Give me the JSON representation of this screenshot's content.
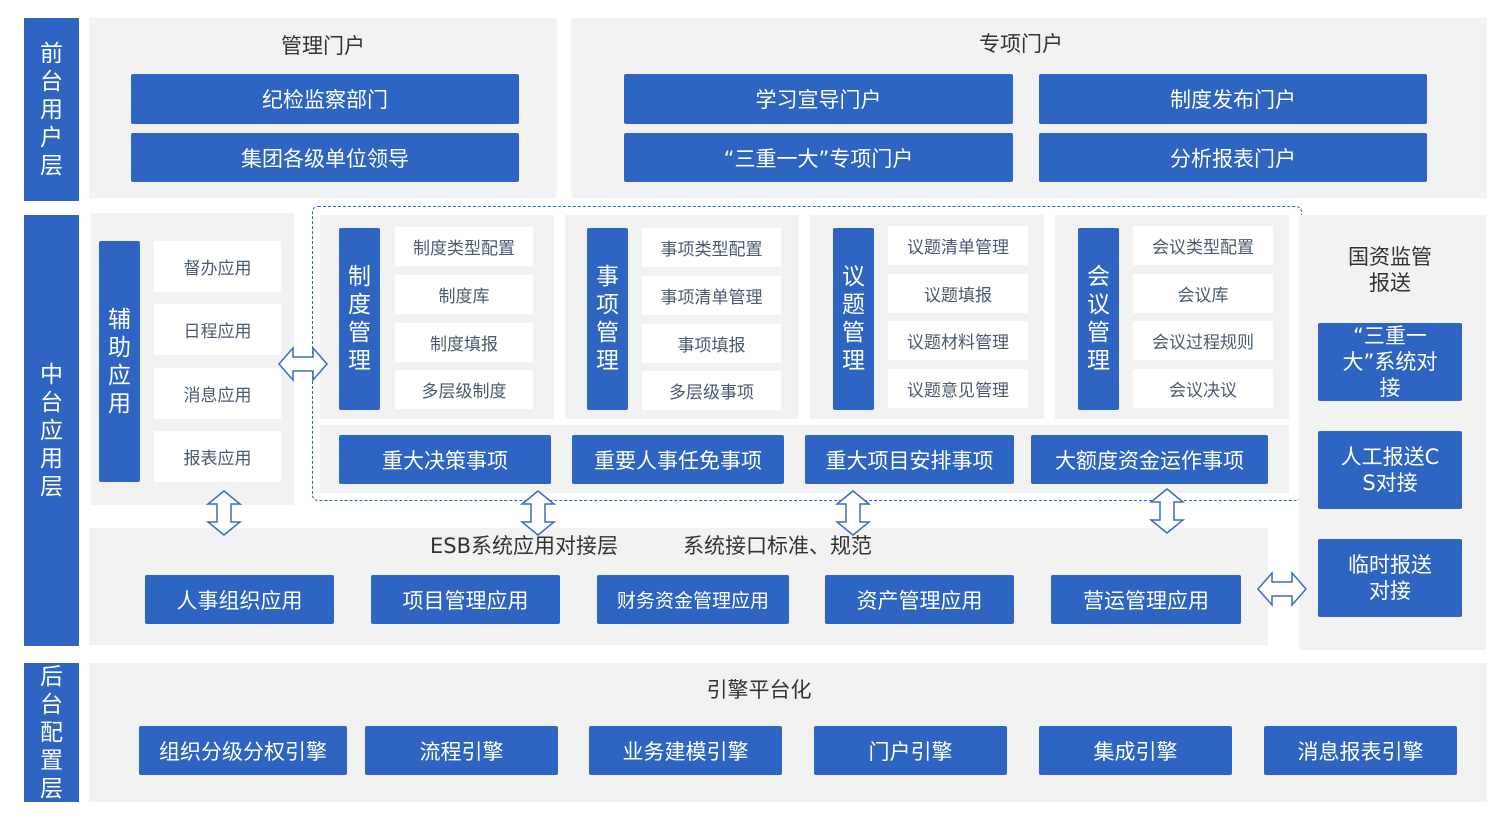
{
  "layers": {
    "front": "前台用户层",
    "middle": "中台应用层",
    "back": "后台配置层"
  },
  "front": {
    "mgmt_portal": {
      "title": "管理门户",
      "items": [
        "纪检监察部门",
        "集团各级单位领导"
      ]
    },
    "special_portal": {
      "title": "专项门户",
      "items": [
        "学习宣导门户",
        "制度发布门户",
        "“三重一大”专项门户",
        "分析报表门户"
      ]
    }
  },
  "middle": {
    "aux": {
      "label": "辅助应用",
      "items": [
        "督办应用",
        "日程应用",
        "消息应用",
        "报表应用"
      ]
    },
    "modules": [
      {
        "label": "制度管理",
        "items": [
          "制度类型配置",
          "制度库",
          "制度填报",
          "多层级制度"
        ]
      },
      {
        "label": "事项管理",
        "items": [
          "事项类型配置",
          "事项清单管理",
          "事项填报",
          "多层级事项"
        ]
      },
      {
        "label": "议题管理",
        "items": [
          "议题清单管理",
          "议题填报",
          "议题材料管理",
          "议题意见管理"
        ]
      },
      {
        "label": "会议管理",
        "items": [
          "会议类型配置",
          "会议库",
          "会议过程规则",
          "会议决议"
        ]
      }
    ],
    "matters": [
      "重大决策事项",
      "重要人事任免事项",
      "重大项目安排事项",
      "大额度资金运作事项"
    ],
    "esb": {
      "title": "ESB系统应用对接层",
      "subtitle": "系统接口标准、规范",
      "apps": [
        "人事组织应用",
        "项目管理应用",
        "财务资金管理应用",
        "资产管理应用",
        "营运管理应用"
      ]
    },
    "sasac": {
      "title": "国资监管报送",
      "items": [
        "“三重一大”系统对接",
        "人工报送CS对接",
        "临时报送对接"
      ]
    }
  },
  "back": {
    "title": "引擎平台化",
    "engines": [
      "组织分级分权引擎",
      "流程引擎",
      "业务建模引擎",
      "门户引擎",
      "集成引擎",
      "消息报表引擎"
    ]
  },
  "colors": {
    "primary": "#2e64c2",
    "panel": "#f2f2f2",
    "card_text": "#4a5a72"
  }
}
